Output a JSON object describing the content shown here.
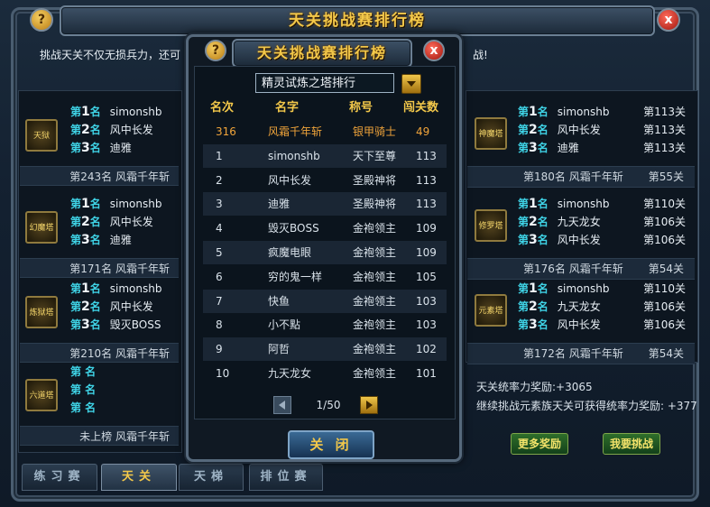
{
  "outer": {
    "title": "天关挑战赛排行榜",
    "notice": "挑战天关不仅无损兵力，还可",
    "notice_tail": "战!",
    "help": "?",
    "close": "x"
  },
  "left_groups": [
    {
      "emblem": "天狱",
      "names": [
        "simonshb",
        "风中长发",
        "迪雅"
      ],
      "mine": "第243名 风霜千年斩"
    },
    {
      "emblem": "幻魔塔",
      "names": [
        "simonshb",
        "风中长发",
        "迪雅"
      ],
      "mine": "第171名 风霜千年斩"
    },
    {
      "emblem": "炼狱塔",
      "names": [
        "simonshb",
        "风中长发",
        "毁灭BOSS"
      ],
      "mine": "第210名 风霜千年斩"
    },
    {
      "emblem": "六道塔",
      "names": [
        "",
        "",
        ""
      ],
      "mine": "未上榜 风霜千年斩"
    }
  ],
  "right_groups": [
    {
      "emblem": "神魔塔",
      "names": [
        "simonshb",
        "风中长发",
        "迪雅"
      ],
      "levels": [
        "第113关",
        "第113关",
        "第113关"
      ],
      "mine": "第180名 风霜千年斩",
      "mine_level": "第55关"
    },
    {
      "emblem": "修罗塔",
      "names": [
        "simonshb",
        "九天龙女",
        "风中长发"
      ],
      "levels": [
        "第110关",
        "第106关",
        "第106关"
      ],
      "mine": "第176名 风霜千年斩",
      "mine_level": "第54关"
    },
    {
      "emblem": "元素塔",
      "names": [
        "simonshb",
        "九天龙女",
        "风中长发"
      ],
      "levels": [
        "第110关",
        "第106关",
        "第106关"
      ],
      "mine": "第172名 风霜千年斩",
      "mine_level": "第54关"
    }
  ],
  "rank_labels": [
    {
      "pre": "第",
      "num": "1",
      "post": "名"
    },
    {
      "pre": "第",
      "num": "2",
      "post": "名"
    },
    {
      "pre": "第",
      "num": "3",
      "post": "名"
    }
  ],
  "empty_rank_label": "第 名",
  "rewards": {
    "line1": "天关统率力奖励:+3065",
    "line2": "继续挑战元素族天关可获得统率力奖励: +377",
    "more_button": "更多奖励",
    "challenge_button": "我要挑战"
  },
  "tabs": [
    {
      "label": "练习赛",
      "active": false
    },
    {
      "label": "天关",
      "active": true
    },
    {
      "label": "天梯",
      "active": false
    },
    {
      "label": "排位赛",
      "active": false
    }
  ],
  "modal": {
    "title": "天关挑战赛排行榜",
    "help": "?",
    "close": "x",
    "dropdown_value": "精灵试炼之塔排行",
    "headers": [
      "名次",
      "名字",
      "称号",
      "闯关数"
    ],
    "rows": [
      {
        "rank": "316",
        "name": "风霜千年斩",
        "title": "银甲骑士",
        "count": "49",
        "me": true
      },
      {
        "rank": "1",
        "name": "simonshb",
        "title": "天下至尊",
        "count": "113"
      },
      {
        "rank": "2",
        "name": "风中长发",
        "title": "圣殿神将",
        "count": "113"
      },
      {
        "rank": "3",
        "name": "迪雅",
        "title": "圣殿神将",
        "count": "113"
      },
      {
        "rank": "4",
        "name": "毁灭BOSS",
        "title": "金袍领主",
        "count": "109"
      },
      {
        "rank": "5",
        "name": "疯魔电眼",
        "title": "金袍领主",
        "count": "109"
      },
      {
        "rank": "6",
        "name": "穷的鬼一样",
        "title": "金袍领主",
        "count": "105"
      },
      {
        "rank": "7",
        "name": "快鱼",
        "title": "金袍领主",
        "count": "103"
      },
      {
        "rank": "8",
        "name": "小不點",
        "title": "金袍领主",
        "count": "103"
      },
      {
        "rank": "9",
        "name": "阿哲",
        "title": "金袍领主",
        "count": "102"
      },
      {
        "rank": "10",
        "name": "九天龙女",
        "title": "金袍领主",
        "count": "101"
      }
    ],
    "page_text": "1/50",
    "close_button": "关 闭"
  },
  "colors": {
    "accent_gold": "#f3c84a",
    "rank_cyan": "#3fd3e6",
    "me_orange": "#f0a43a"
  }
}
